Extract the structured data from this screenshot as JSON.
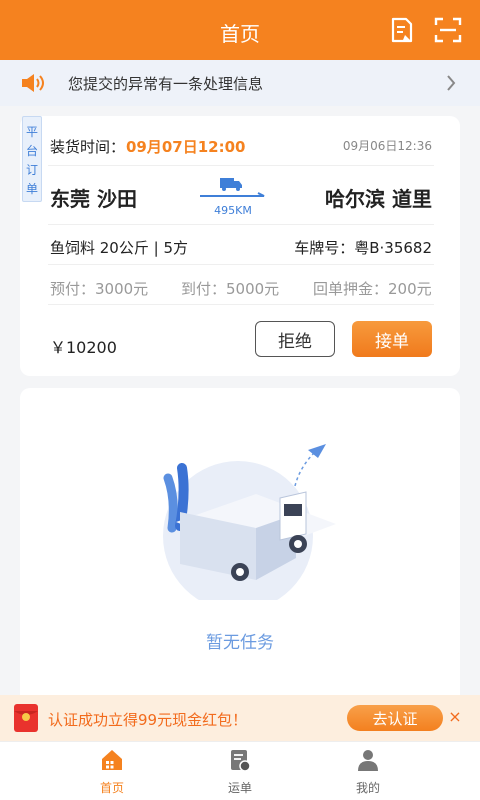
{
  "header": {
    "title": "首页",
    "doc_icon": "document-edit-icon",
    "scan_icon": "scan-icon"
  },
  "notice": {
    "icon": "speaker-icon",
    "text": "您提交的异常有一条处理信息",
    "arrow_icon": "chevron-right-icon"
  },
  "order": {
    "tag": "平台订单",
    "load_time_label": "装货时间：",
    "load_time": "09月07日12:00",
    "publish_time": "09月06日12:36",
    "origin": "东莞  沙田",
    "destination": "哈尔滨  道里",
    "distance": "495KM",
    "cargo": "鱼饲料  20公斤 | 5方",
    "plate": "车牌号：粤B·35682",
    "prepay": "预付：3000元",
    "on_arrival": "到付：5000元",
    "receipt_deposit": "回单押金：200元",
    "price": "￥10200",
    "reject_label": "拒绝",
    "accept_label": "接单"
  },
  "empty": {
    "text": "暂无任务",
    "illustration": "empty-truck-illustration"
  },
  "promo": {
    "icon": "red-envelope-icon",
    "text": "认证成功立得99元现金红包！",
    "button": "去认证",
    "close": "×"
  },
  "tabs": [
    {
      "label": "首页",
      "icon": "home-icon",
      "active": true
    },
    {
      "label": "运单",
      "icon": "waybill-icon",
      "active": false
    },
    {
      "label": "我的",
      "icon": "user-icon",
      "active": false
    }
  ],
  "colors": {
    "primary": "#f5821f",
    "accent_blue": "#3f7fd8",
    "promo_bg": "#fdeede"
  }
}
